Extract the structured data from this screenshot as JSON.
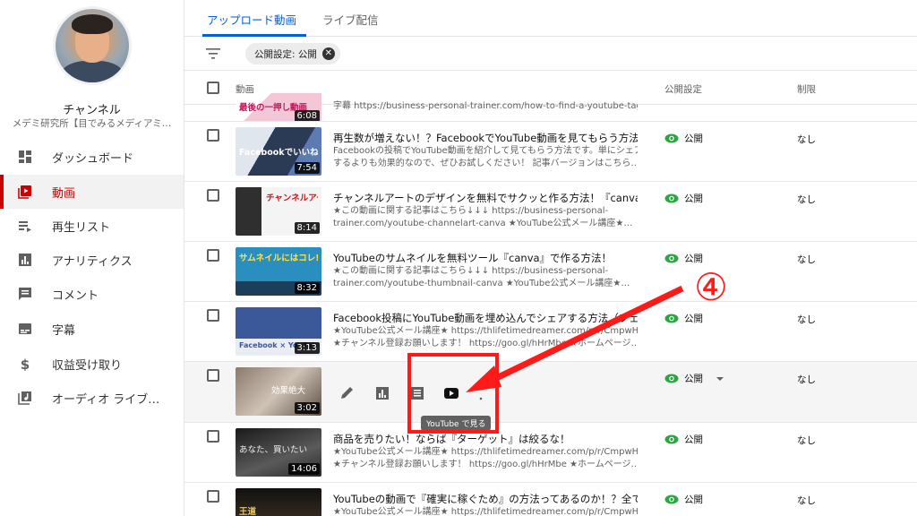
{
  "sidebar": {
    "channel_name": "チャンネル",
    "channel_desc": "メデミ研究所【目でみるメディアミ…",
    "items": [
      {
        "label": "ダッシュボード",
        "icon": "dashboard-icon"
      },
      {
        "label": "動画",
        "icon": "video-icon",
        "active": true
      },
      {
        "label": "再生リスト",
        "icon": "playlist-icon"
      },
      {
        "label": "アナリティクス",
        "icon": "analytics-icon"
      },
      {
        "label": "コメント",
        "icon": "comment-icon"
      },
      {
        "label": "字幕",
        "icon": "subtitles-icon"
      },
      {
        "label": "収益受け取り",
        "icon": "dollar-icon"
      },
      {
        "label": "オーディオ ライブ…",
        "icon": "audio-library-icon"
      }
    ]
  },
  "tabs": {
    "upload": "アップロード動画",
    "live": "ライブ配信"
  },
  "filter": {
    "chip": "公開設定: 公開",
    "close": "✕"
  },
  "header": {
    "video": "動画",
    "visibility": "公開設定",
    "restriction": "制限"
  },
  "colors": {
    "accent": "#065fd4",
    "active": "#cc0000",
    "visible_green": "#2ba640",
    "annotation": "#ff1a1a"
  },
  "rows": [
    {
      "title": "",
      "desc1": "字幕 https://business-personal-trainer.com/how-to-find-a-youtube-tag...",
      "desc2": "",
      "duration": "6:08",
      "visibility": "",
      "restriction": "",
      "thumb_text": "最後の一押し動画"
    },
    {
      "title": "再生数が増えない！？FacebookでYouTube動画を見てもらう方法【ア…",
      "desc1": "Facebookの投稿でYouTube動画を紹介して見てもらう方法です。単にシェア",
      "desc2": "するよりも効果的なので、ぜひお試しください！ 記事バージョンはこちら…",
      "duration": "7:54",
      "visibility": "公開",
      "restriction": "なし",
      "thumb_text": "Facebookでいいね YouTube"
    },
    {
      "title": "チャンネルアートのデザインを無料でサクッと作る方法！『canva』を…",
      "desc1": "★この動画に関する記事はこちら↓↓↓ https://business-personal-",
      "desc2": "trainer.com/youtube-channelart-canva ★YouTube公式メール講座★…",
      "duration": "8:14",
      "visibility": "公開",
      "restriction": "なし",
      "thumb_text": "チャンネルアート デザインのコツ"
    },
    {
      "title": "YouTubeのサムネイルを無料ツール『canva』で作る方法！",
      "desc1": "★この動画に関する記事はこちら↓↓↓ https://business-personal-",
      "desc2": "trainer.com/youtube-thumbnail-canva ★YouTube公式メール講座★…",
      "duration": "8:32",
      "visibility": "公開",
      "restriction": "なし",
      "thumb_text": "サムネイルにはコレ! Canva 使いやすいしか"
    },
    {
      "title": "Facebook投稿にYouTube動画を埋め込んでシェアする方法（フェイス…",
      "desc1": "★YouTube公式メール講座★ https://thlifetimedreamer.com/p/r/CmpwHBSX",
      "desc2": "★チャンネル登録お願いします！ https://goo.gl/hHrMbe ★ホームページ…",
      "duration": "3:13",
      "visibility": "公開",
      "restriction": "なし",
      "thumb_text": "Facebook × YouTube"
    },
    {
      "title": "",
      "desc1": "",
      "desc2": "",
      "duration": "3:02",
      "visibility": "公開",
      "restriction": "なし",
      "thumb_text": "効果絶大",
      "hover": true,
      "tooltip": "YouTube で見る",
      "actions": [
        "edit-icon",
        "analytics-icon",
        "comments-icon",
        "youtube-icon",
        "more-icon"
      ]
    },
    {
      "title": "商品を売りたい！ならば『ターゲット』は絞るな！",
      "desc1": "★YouTube公式メール講座★ https://thlifetimedreamer.com/p/r/CmpwHBSX",
      "desc2": "★チャンネル登録お願いします！ https://goo.gl/hHrMbe ★ホームページ…",
      "duration": "14:06",
      "visibility": "公開",
      "restriction": "なし",
      "thumb_text": "あなた、買いたい"
    },
    {
      "title": "YouTubeの動画で『確実に稼ぐため』の方法ってあるのか！？全ての…",
      "desc1": "★YouTube公式メール講座★ https://thlifetimedreamer.com/p/r/CmpwHBSX",
      "desc2": "",
      "duration": "",
      "visibility": "公開",
      "restriction": "なし",
      "thumb_text": "王道"
    }
  ],
  "annotation": {
    "step": "④"
  }
}
